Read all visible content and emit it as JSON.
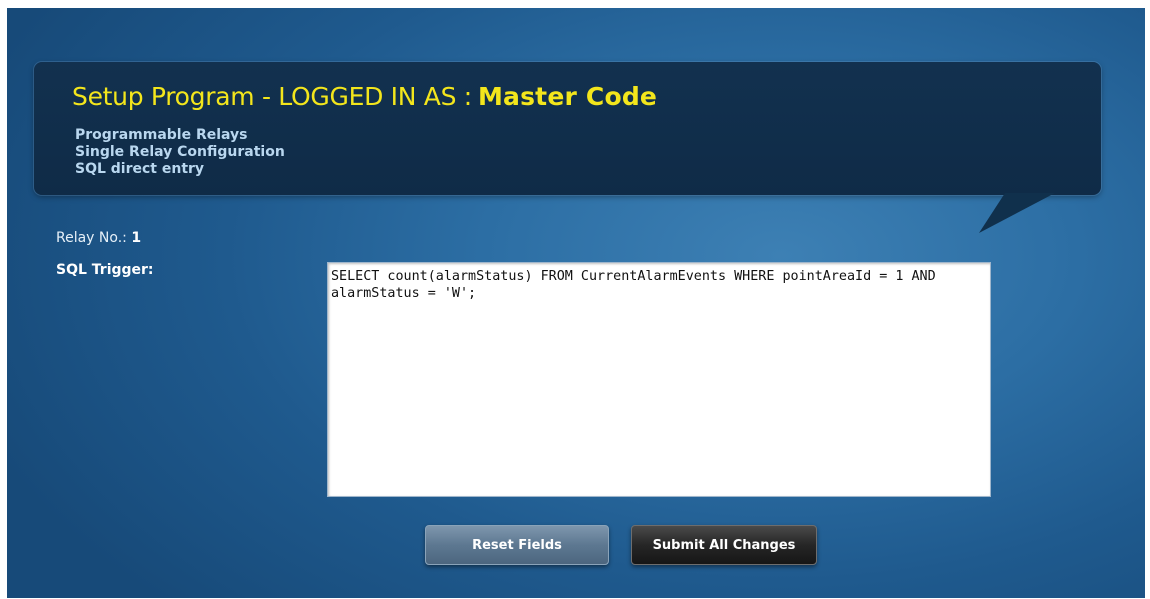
{
  "header": {
    "title": "Setup Program - LOGGED IN AS :",
    "user": "Master Code",
    "breadcrumbs": [
      "Programmable Relays",
      "Single Relay Configuration",
      "SQL direct entry"
    ]
  },
  "relay": {
    "label": "Relay No.:",
    "number": "1"
  },
  "sql": {
    "label": "SQL Trigger:",
    "value": "SELECT count(alarmStatus) FROM CurrentAlarmEvents WHERE pointAreaId = 1 AND alarmStatus = 'W';"
  },
  "buttons": {
    "reset": "Reset Fields",
    "submit": "Submit All Changes"
  },
  "colors": {
    "title": "#f3e61c",
    "bubble": "#12314f",
    "background": "#2c6ea4"
  }
}
